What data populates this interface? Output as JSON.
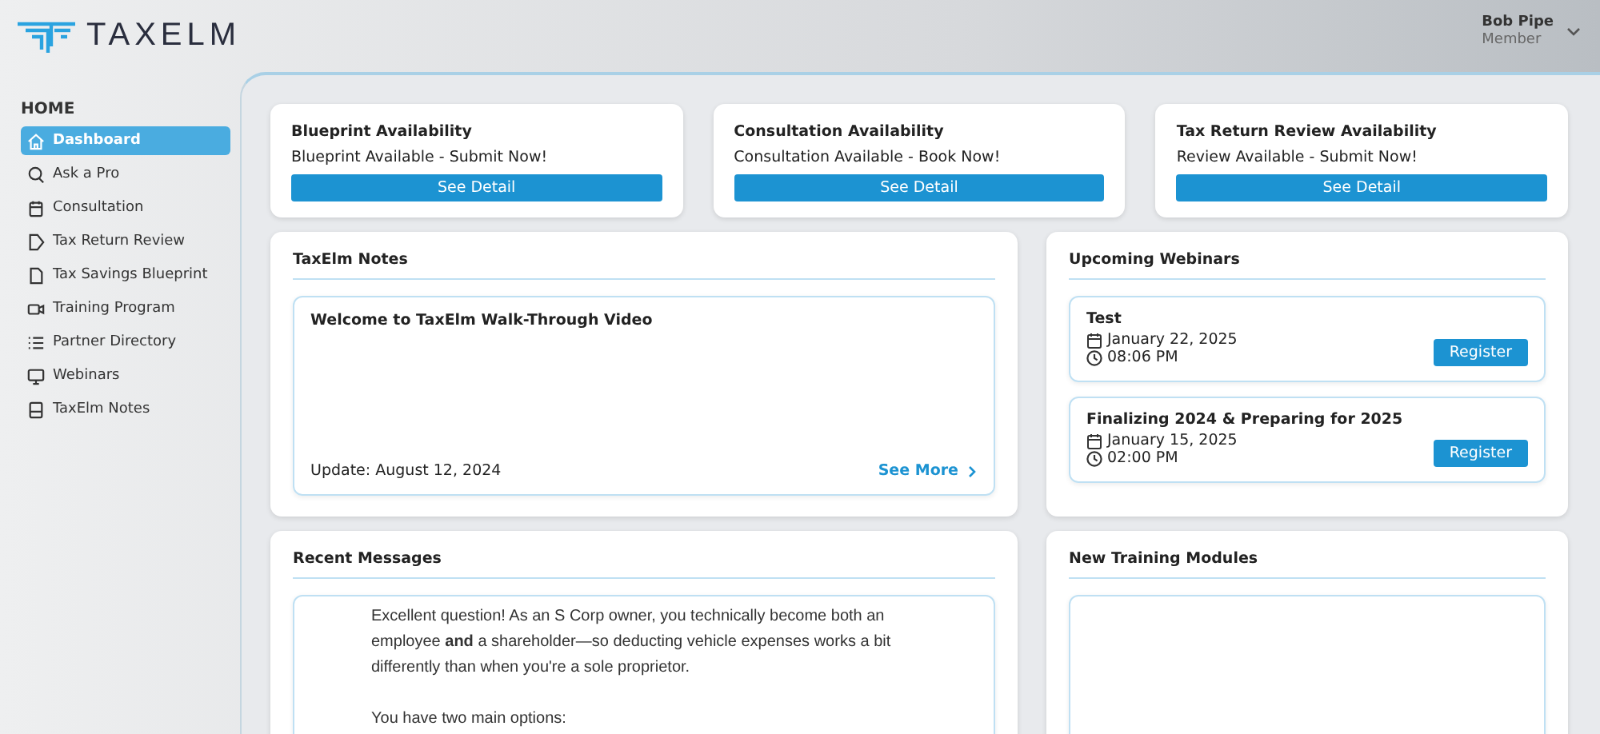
{
  "header": {
    "logo_text": "TAXELM",
    "user": {
      "name": "Bob Pipe",
      "role": "Member"
    }
  },
  "sidebar": {
    "section": "HOME",
    "items": [
      {
        "label": "Dashboard",
        "selected": true
      },
      {
        "label": "Ask a Pro",
        "selected": false
      },
      {
        "label": "Consultation",
        "selected": false
      },
      {
        "label": "Tax Return Review",
        "selected": false
      },
      {
        "label": "Tax Savings Blueprint",
        "selected": false
      },
      {
        "label": "Training Program",
        "selected": false
      },
      {
        "label": "Partner Directory",
        "selected": false
      },
      {
        "label": "Webinars",
        "selected": false
      },
      {
        "label": "TaxElm Notes",
        "selected": false
      }
    ]
  },
  "availability": [
    {
      "title": "Blueprint Availability",
      "status": "Blueprint Available - Submit Now!",
      "button": "See Detail"
    },
    {
      "title": "Consultation Availability",
      "status": "Consultation Available - Book Now!",
      "button": "See Detail"
    },
    {
      "title": "Tax Return Review Availability",
      "status": "Review Available - Submit Now!",
      "button": "See Detail"
    }
  ],
  "notes": {
    "title": "TaxElm Notes",
    "items": [
      {
        "title": "Welcome to TaxElm Walk-Through Video",
        "updated": "Update: August 12, 2024",
        "link": "See More"
      }
    ]
  },
  "webinars": {
    "title": "Upcoming Webinars",
    "items": [
      {
        "title": "Test",
        "date": "January 22, 2025",
        "time": "08:06 PM",
        "button": "Register"
      },
      {
        "title": "Finalizing 2024 & Preparing for 2025",
        "date": "January 15, 2025",
        "time": "02:00 PM",
        "button": "Register"
      }
    ]
  },
  "messages": {
    "title": "Recent Messages",
    "paragraphs": [
      "Excellent question! As an S Corp owner, you technically become both an employee **and** a shareholder—so deducting vehicle expenses works a bit differently than when you're a sole proprietor.",
      "You have two main options:"
    ]
  },
  "training": {
    "title": "New Training Modules"
  }
}
